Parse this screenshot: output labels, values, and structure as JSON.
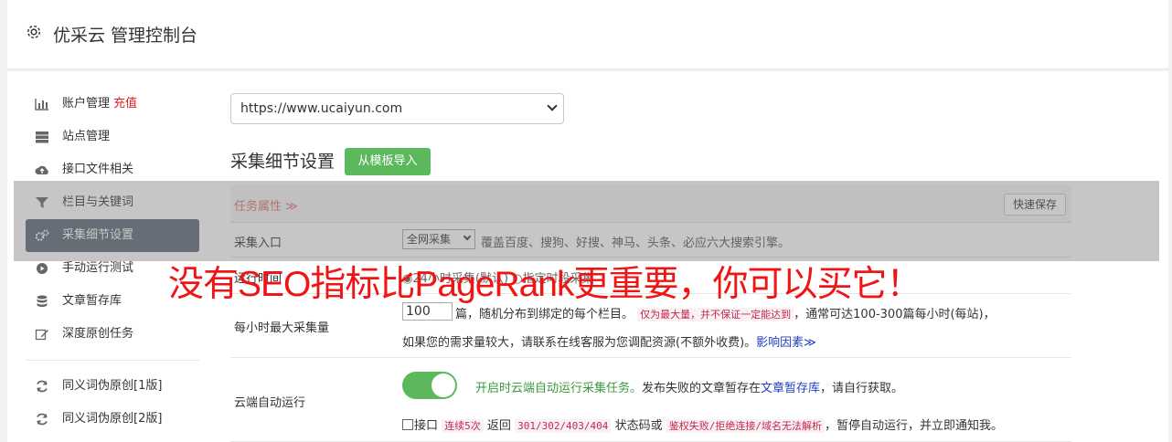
{
  "header": {
    "title": "优采云 管理控制台",
    "icon": "gear-icon"
  },
  "sidebar": {
    "items": [
      {
        "label": "账户管理",
        "badge": "充值",
        "icon": "bar-chart-icon"
      },
      {
        "label": "站点管理",
        "icon": "server-icon"
      },
      {
        "label": "接口文件相关",
        "icon": "cloud-upload-icon"
      },
      {
        "label": "栏目与关键词",
        "icon": "filter-icon"
      },
      {
        "label": "采集细节设置",
        "icon": "gears-icon",
        "active": true
      },
      {
        "label": "手动运行测试",
        "icon": "play-circle-icon"
      },
      {
        "label": "文章暂存库",
        "icon": "database-icon"
      },
      {
        "label": "深度原创任务",
        "icon": "edit-icon"
      },
      {
        "label": "同义词伪原创[1版]",
        "icon": "refresh-icon"
      },
      {
        "label": "同义词伪原创[2版]",
        "icon": "refresh-icon"
      }
    ]
  },
  "main": {
    "site_select": "https://www.ucaiyun.com",
    "section_title": "采集细节设置",
    "import_button": "从模板导入",
    "task_props": "任务属性 ≫",
    "quick_save": "快速保存",
    "rows": {
      "entry": {
        "label": "采集入口",
        "select": "全网采集",
        "desc": "覆盖百度、搜狗、好搜、神马、头条、必应六大搜索引擎。"
      },
      "runtime": {
        "label": "运行时间",
        "options": "◉24小时采集(默认) ○指定时段采集"
      },
      "max_per_hour": {
        "label": "每小时最大采集量",
        "value": "100",
        "text_a": "篇，随机分布到绑定的每个栏目。",
        "code": "仅为最大量，并不保证一定能达到",
        "text_b": "，通常可达100-300篇每小时(每站)，",
        "text_c": "如果您的需求量较大，请联系在线客服为您调配资源(不额外收费)。",
        "link": "影响因素≫"
      },
      "cloud_run": {
        "label": "云端自动运行",
        "on": true,
        "t1_green": "开启时云端自动运行采集任务。",
        "t1_text": "发布失败的文章暂存在",
        "t1_link": "文章暂存库",
        "t1_tail": "，请自行获取。",
        "t2_a": "接口",
        "t2_code1": "连续5次",
        "t2_b": "返回",
        "t2_code2": "301/302/403/404",
        "t2_c": "状态码或",
        "t2_code3": "鉴权失败/拒绝连接/域名无法解析",
        "t2_d": "，暂停自动运行，并立即通知我。"
      }
    }
  },
  "banner": "没有SEO指标比PageRank更重要，你可以买它！",
  "colors": {
    "accent_green": "#5cb85c",
    "active_bg": "#5b6776",
    "banner_red": "#f01414"
  }
}
